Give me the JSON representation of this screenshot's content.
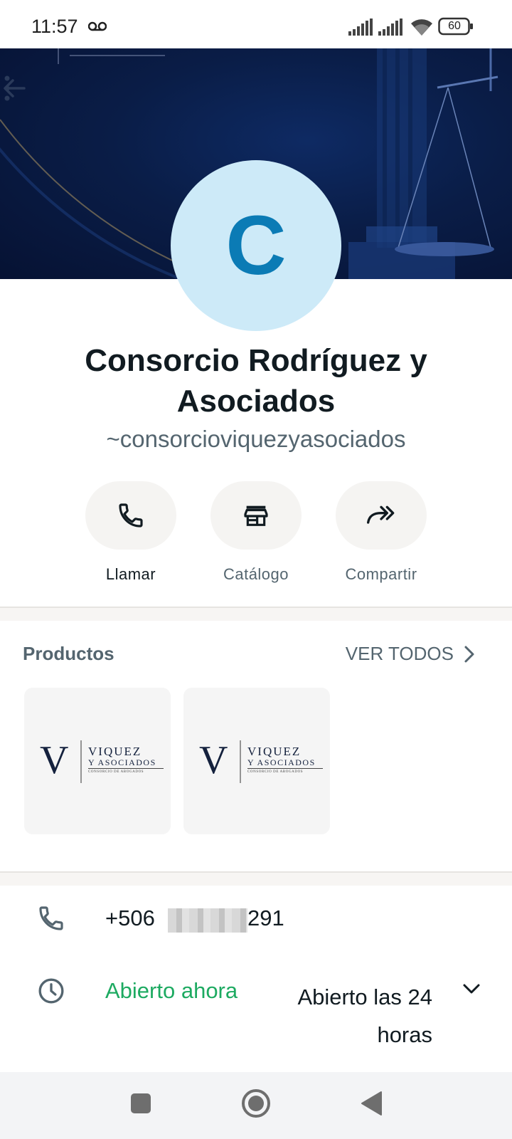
{
  "status_bar": {
    "time": "11:57",
    "battery": "60"
  },
  "profile": {
    "avatar_letter": "C",
    "name": "Consorcio Rodríguez y Asociados",
    "handle": "~consorcioviquezyasociados"
  },
  "actions": [
    {
      "label": "Llamar",
      "icon": "phone-icon"
    },
    {
      "label": "Catálogo",
      "icon": "storefront-icon"
    },
    {
      "label": "Compartir",
      "icon": "forward-icon"
    }
  ],
  "products": {
    "title": "Productos",
    "see_all": "VER TODOS",
    "items": [
      {
        "logo_line1": "VIQUEZ",
        "logo_line2": "Y ASOCIADOS",
        "logo_line3": "CONSORCIO DE ABOGADOS"
      },
      {
        "logo_line1": "VIQUEZ",
        "logo_line2": "Y ASOCIADOS",
        "logo_line3": "CONSORCIO DE ABOGADOS"
      }
    ]
  },
  "contact": {
    "phone_prefix": "+506",
    "phone_suffix": "291",
    "open_status": "Abierto ahora",
    "hours": "Abierto las 24 horas"
  },
  "colors": {
    "accent_green": "#1daa61",
    "avatar_bg": "#cdeaf8",
    "avatar_letter": "#0b7bb5",
    "cover": "#0a1d47"
  }
}
